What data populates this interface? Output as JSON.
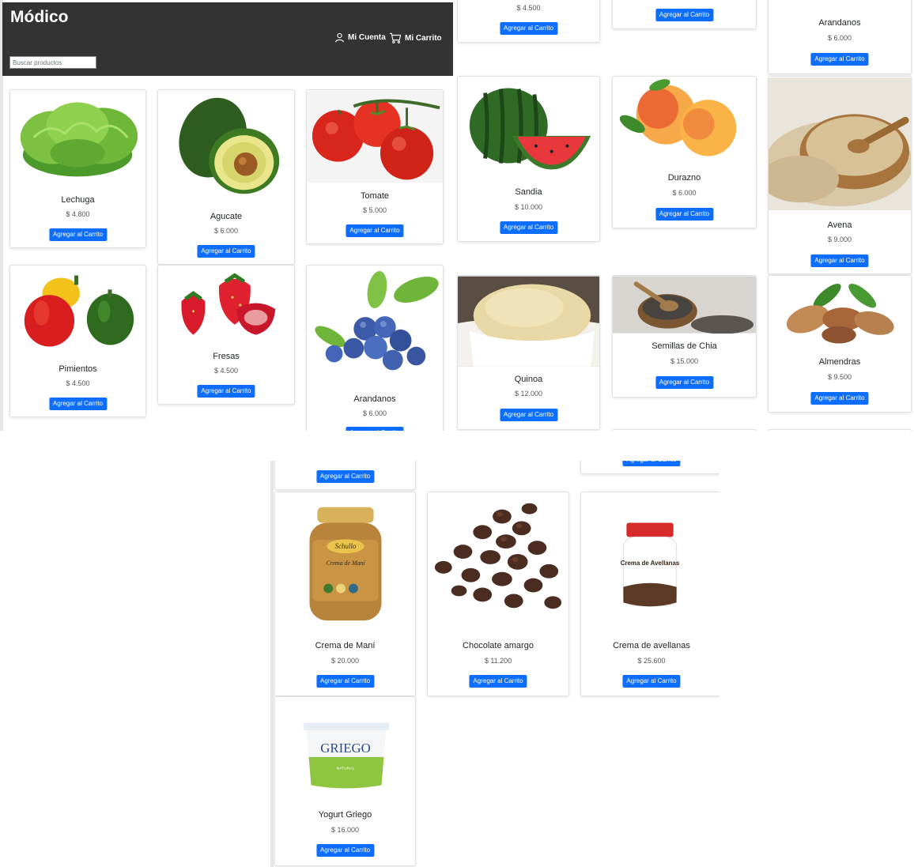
{
  "header": {
    "brand": "Módico",
    "account_label": "Mi Cuenta",
    "cart_label": "Mi Carrito",
    "search_placeholder": "Buscar productos"
  },
  "add_label": "Agregar al Carrito",
  "panel_a": [
    {
      "name": "Lechuga",
      "price": "$ 4.800",
      "image": "lettuce"
    },
    {
      "name": "Agucate",
      "price": "$ 6.000",
      "image": "avocado"
    },
    {
      "name": "Tomate",
      "price": "$ 5.000",
      "image": "tomato"
    },
    {
      "name": "Pimientos",
      "price": "$ 4.500",
      "image": "peppers"
    },
    {
      "name": "Fresas",
      "price": "$ 4.500",
      "image": "strawberries"
    },
    {
      "name": "Arandanos",
      "price": "$ 6.000",
      "image": "blueberries"
    }
  ],
  "panel_b": {
    "top_price": "$ 4.500",
    "top_right": {
      "name": "Arandanos",
      "price": "$ 6.000"
    },
    "products": [
      {
        "name": "Sandia",
        "price": "$ 10.000",
        "image": "watermelon"
      },
      {
        "name": "Durazno",
        "price": "$ 6.000",
        "image": "peach"
      },
      {
        "name": "Avena",
        "price": "$ 9.000",
        "image": "oats"
      },
      {
        "name": "Quinoa",
        "price": "$ 12.000",
        "image": "quinoa"
      },
      {
        "name": "Semillas de Chia",
        "price": "$ 15.000",
        "image": "chia"
      },
      {
        "name": "Almendras",
        "price": "$ 9.500",
        "image": "almonds"
      }
    ]
  },
  "panel_c": [
    {
      "name": "Crema de Maní",
      "price": "$ 20.000",
      "image": "peanut-butter-jar",
      "label_text": "Schullo",
      "label_text2": "Crema de Maní"
    },
    {
      "name": "Chocolate amargo",
      "price": "$ 11.200",
      "image": "chocolate-chips"
    },
    {
      "name": "Crema de avellanas",
      "price": "$ 25.600",
      "image": "hazelnut-jar",
      "label_text": "Crema de Avellanas"
    },
    {
      "name": "Yogurt Griego",
      "price": "$ 16.000",
      "image": "yogurt-cup",
      "label_text": "GRIEGO",
      "label_text2": "NATURAL"
    }
  ],
  "colors": {
    "header": "#333333",
    "button": "#0d6efd"
  }
}
